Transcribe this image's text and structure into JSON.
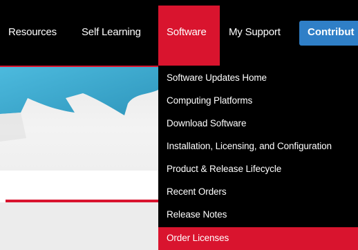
{
  "nav": {
    "items": [
      {
        "label": "Resources"
      },
      {
        "label": "Self Learning"
      },
      {
        "label": "Software"
      },
      {
        "label": "My Support"
      }
    ],
    "cta_label": "Contribut"
  },
  "dropdown": {
    "items": [
      {
        "label": "Software Updates Home"
      },
      {
        "label": "Computing Platforms"
      },
      {
        "label": "Download Software"
      },
      {
        "label": "Installation, Licensing, and Configuration"
      },
      {
        "label": "Product & Release Lifecycle"
      },
      {
        "label": "Recent Orders"
      },
      {
        "label": "Release Notes"
      },
      {
        "label": "Order Licenses"
      }
    ],
    "hovered_index": 7
  },
  "colors": {
    "nav_bg": "#000000",
    "accent_red": "#d9142e",
    "cta_blue": "#2f7fc7",
    "hero_shape": "#2aa6cf"
  }
}
